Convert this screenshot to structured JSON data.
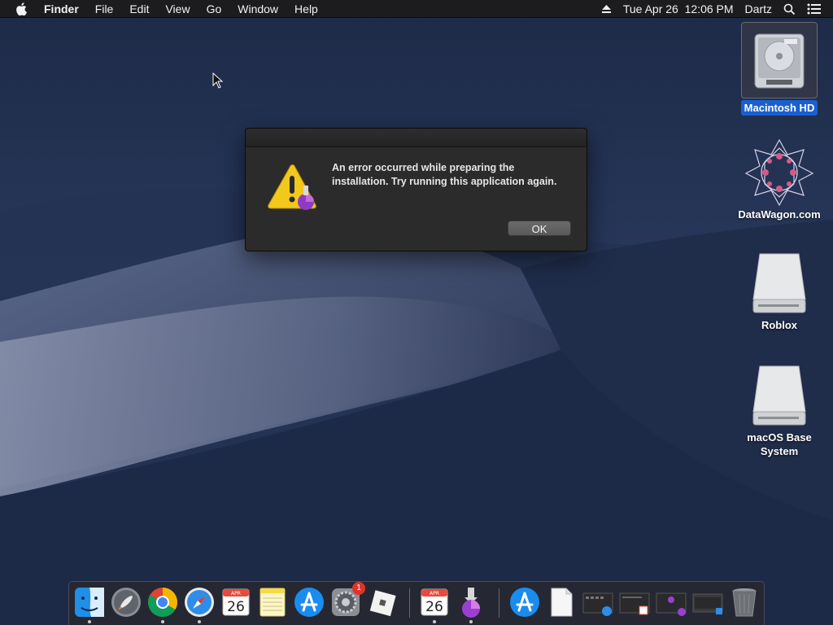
{
  "menubar": {
    "app_name": "Finder",
    "menus": [
      "File",
      "Edit",
      "View",
      "Go",
      "Window",
      "Help"
    ],
    "datetime": "Tue Apr 26  12:06 PM",
    "user": "Dartz"
  },
  "desktop_icons": [
    {
      "label": "Macintosh HD",
      "icon": "internal-drive-icon",
      "selected": true
    },
    {
      "label": "DataWagon.com",
      "icon": "datawagon-icon",
      "selected": false
    },
    {
      "label": "Roblox",
      "icon": "external-drive-icon",
      "selected": false
    },
    {
      "label": "macOS Base System",
      "icon": "external-drive-icon",
      "selected": false
    }
  ],
  "alert": {
    "message": "An error occurred while preparing the installation. Try running this application again.",
    "ok_label": "OK"
  },
  "dock": {
    "calendar_month": "APR",
    "calendar_day": "26",
    "prefs_badge": "1",
    "items": [
      "Finder",
      "Launchpad",
      "Google Chrome",
      "Safari",
      "Calendar",
      "Notes",
      "App Store",
      "System Preferences",
      "Roblox",
      "Calendar",
      "Install macOS",
      "App Store",
      "Document",
      "Window",
      "Window",
      "Window",
      "Window",
      "Trash"
    ]
  },
  "colors": {
    "selection": "#1a5fd1",
    "alert_bg": "#2b2b2b",
    "menubar_bg": "#1c1c1e"
  }
}
